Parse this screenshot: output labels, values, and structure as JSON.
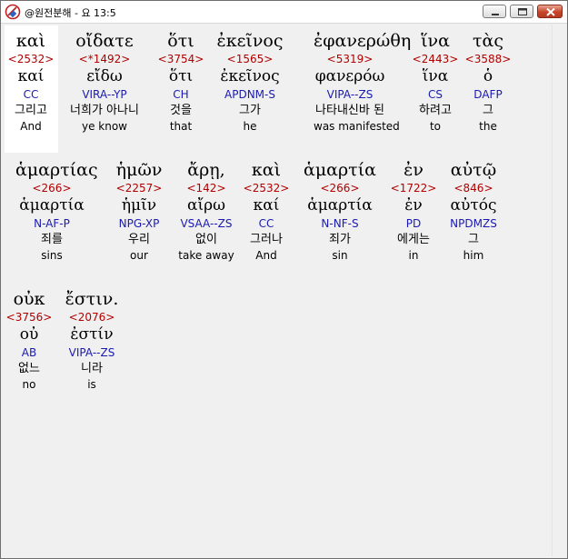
{
  "window": {
    "title": "@원전분해 - 요 13:5",
    "minimize_icon": "minimize-icon",
    "maximize_icon": "maximize-icon",
    "close_icon": "close-icon",
    "app_icon": "bible-app-icon"
  },
  "colors": {
    "strong": "#b00000",
    "parse": "#1a1ab0",
    "background": "#f0f0f0",
    "highlight": "#ffffff"
  },
  "rows": [
    [
      {
        "greek": "καὶ",
        "strong": "<2532>",
        "lemma": "καί",
        "parse": "CC",
        "korean": "그리고",
        "english": "And"
      },
      {
        "greek": "οἴδατε",
        "strong": "<*1492>",
        "lemma": "εἴδω",
        "parse": "VIRA--YP",
        "korean": "너희가 아나니",
        "english": "ye know"
      },
      {
        "greek": "ὅτι",
        "strong": "<3754>",
        "lemma": "ὅτι",
        "parse": "CH",
        "korean": "것을",
        "english": "that"
      },
      {
        "greek": "ἐκεῖνος",
        "strong": "<1565>",
        "lemma": "ἐκεῖνος",
        "parse": "APDNM-S",
        "korean": "그가",
        "english": "he"
      },
      {
        "greek": "ἐφανερώθη",
        "strong": "<5319>",
        "lemma": "φανερόω",
        "parse": "VIPA--ZS",
        "korean": "나타내신바 된",
        "english": "was manifested"
      },
      {
        "greek": "ἵνα",
        "strong": "<2443>",
        "lemma": "ἵνα",
        "parse": "CS",
        "korean": "하려고",
        "english": "to"
      },
      {
        "greek": "τὰς",
        "strong": "<3588>",
        "lemma": "ὁ",
        "parse": "DAFP",
        "korean": "그",
        "english": "the"
      }
    ],
    [
      {
        "greek": "ἁμαρτίας",
        "strong": "<266>",
        "lemma": "ἁμαρτία",
        "parse": "N-AF-P",
        "korean": "죄를",
        "english": "sins"
      },
      {
        "greek": "ἡμῶν",
        "strong": "<2257>",
        "lemma": "ἡμῖν",
        "parse": "NPG-XP",
        "korean": "우리",
        "english": "our"
      },
      {
        "greek": "ἄρῃ,",
        "strong": "<142>",
        "lemma": "αἴρω",
        "parse": "VSAA--ZS",
        "korean": "없이",
        "english": "take away"
      },
      {
        "greek": "καὶ",
        "strong": "<2532>",
        "lemma": "καί",
        "parse": "CC",
        "korean": "그러나",
        "english": "And"
      },
      {
        "greek": "ἁμαρτία",
        "strong": "<266>",
        "lemma": "ἁμαρτία",
        "parse": "N-NF-S",
        "korean": "죄가",
        "english": "sin"
      },
      {
        "greek": "ἐν",
        "strong": "<1722>",
        "lemma": "ἐν",
        "parse": "PD",
        "korean": "에게는",
        "english": "in"
      },
      {
        "greek": "αὐτῷ",
        "strong": "<846>",
        "lemma": "αὐτός",
        "parse": "NPDMZS",
        "korean": "그",
        "english": "him"
      }
    ],
    [
      {
        "greek": "οὐκ",
        "strong": "<3756>",
        "lemma": "οὐ",
        "parse": "AB",
        "korean": "없느",
        "english": "no"
      },
      {
        "greek": "ἔστιν.",
        "strong": "<2076>",
        "lemma": "ἐστίν",
        "parse": "VIPA--ZS",
        "korean": "니라",
        "english": "is"
      }
    ]
  ]
}
